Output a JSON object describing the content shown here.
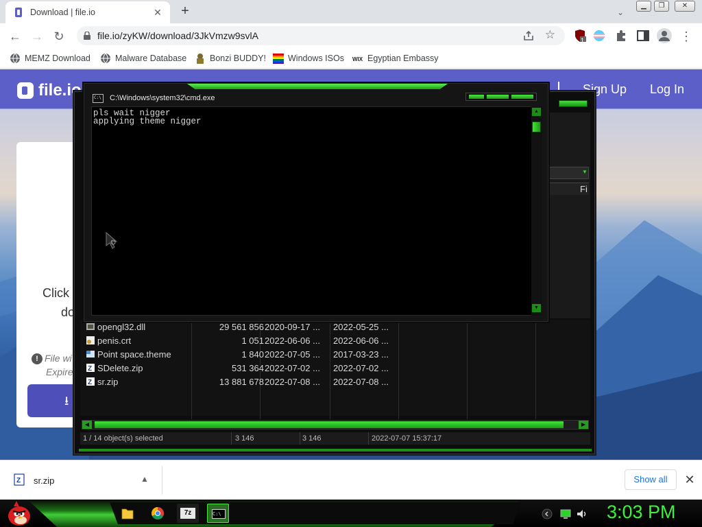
{
  "browser": {
    "tab_title": "Download | file.io",
    "url": "file.io/zyKW/download/3JkVmzw9svlA",
    "extension_badge": "1",
    "bookmarks": [
      {
        "label": "MEMZ Download",
        "icon": "globe-icon"
      },
      {
        "label": "Malware Database",
        "icon": "globe-icon"
      },
      {
        "label": "Bonzi BUDDY!",
        "icon": "bonzi-icon"
      },
      {
        "label": "Windows ISOs",
        "icon": "windows-flag-icon"
      },
      {
        "label": "Egyptian Embassy",
        "icon": "wix-icon"
      }
    ]
  },
  "site": {
    "logo": "file.io",
    "sign_up": "Sign Up",
    "log_in": "Log In",
    "card_click": "Click",
    "card_do": "do",
    "card_file": "File wi",
    "card_expire": "Expire",
    "download_arrow": "⭳"
  },
  "file_manager": {
    "right_label": "Fi",
    "files": [
      {
        "name": "opengl32.dll",
        "size": "29 561 856",
        "modified": "2020-09-17 ...",
        "created": "2022-05-25 ...",
        "icon": "dll-file-icon"
      },
      {
        "name": "penis.crt",
        "size": "1 051",
        "modified": "2022-06-06 ...",
        "created": "2022-06-06 ...",
        "icon": "certificate-file-icon"
      },
      {
        "name": "Point space.theme",
        "size": "1 840",
        "modified": "2022-07-05 ...",
        "created": "2017-03-23 ...",
        "icon": "theme-file-icon"
      },
      {
        "name": "SDelete.zip",
        "size": "531 364",
        "modified": "2022-07-02 ...",
        "created": "2022-07-02 ...",
        "icon": "zip-file-icon"
      },
      {
        "name": "sr.zip",
        "size": "13 881 678",
        "modified": "2022-07-08 ...",
        "created": "2022-07-08 ...",
        "icon": "zip-file-icon"
      }
    ],
    "status": {
      "selection": "1 / 14 object(s) selected",
      "size1": "3 146",
      "size2": "3 146",
      "date": "2022-07-07 15:37:17"
    }
  },
  "cmd": {
    "title": "C:\\Windows\\system32\\cmd.exe",
    "icon_text": "C:\\",
    "lines": [
      "pls wait nigger",
      "applying theme nigger"
    ]
  },
  "downloads": {
    "file": "sr.zip",
    "show_all": "Show all"
  },
  "taskbar": {
    "clock": "3:03 PM",
    "apps": [
      "folder-icon",
      "chrome-icon",
      "7zip-icon",
      "cmd-icon"
    ],
    "app_7zip_text": "7z",
    "app_cmd_text": "C:\\"
  },
  "colors": {
    "accent_green": "#46e53c",
    "fileio_purple": "#5b5fc7",
    "chrome_link": "#1a73e8"
  }
}
